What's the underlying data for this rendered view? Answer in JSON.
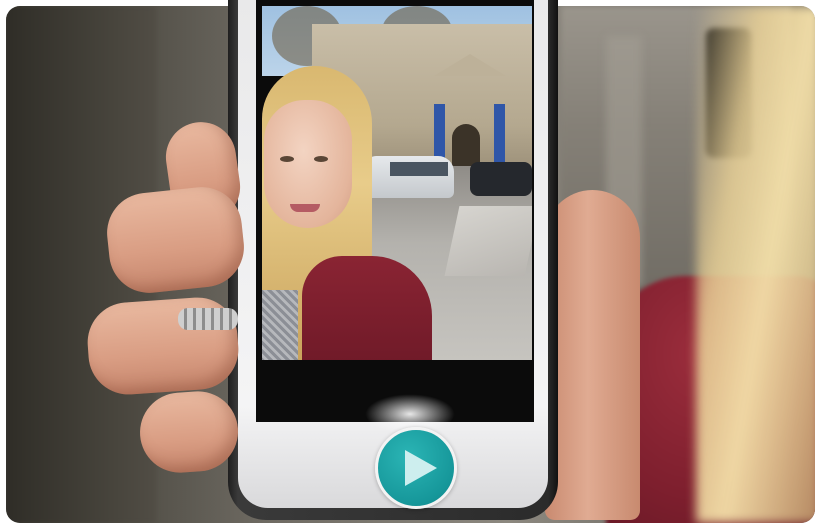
{
  "scene": {
    "subject": "hand-holding-phone",
    "accent_color": "#1a9fa1"
  },
  "video_player": {
    "play_icon": "play-icon"
  }
}
